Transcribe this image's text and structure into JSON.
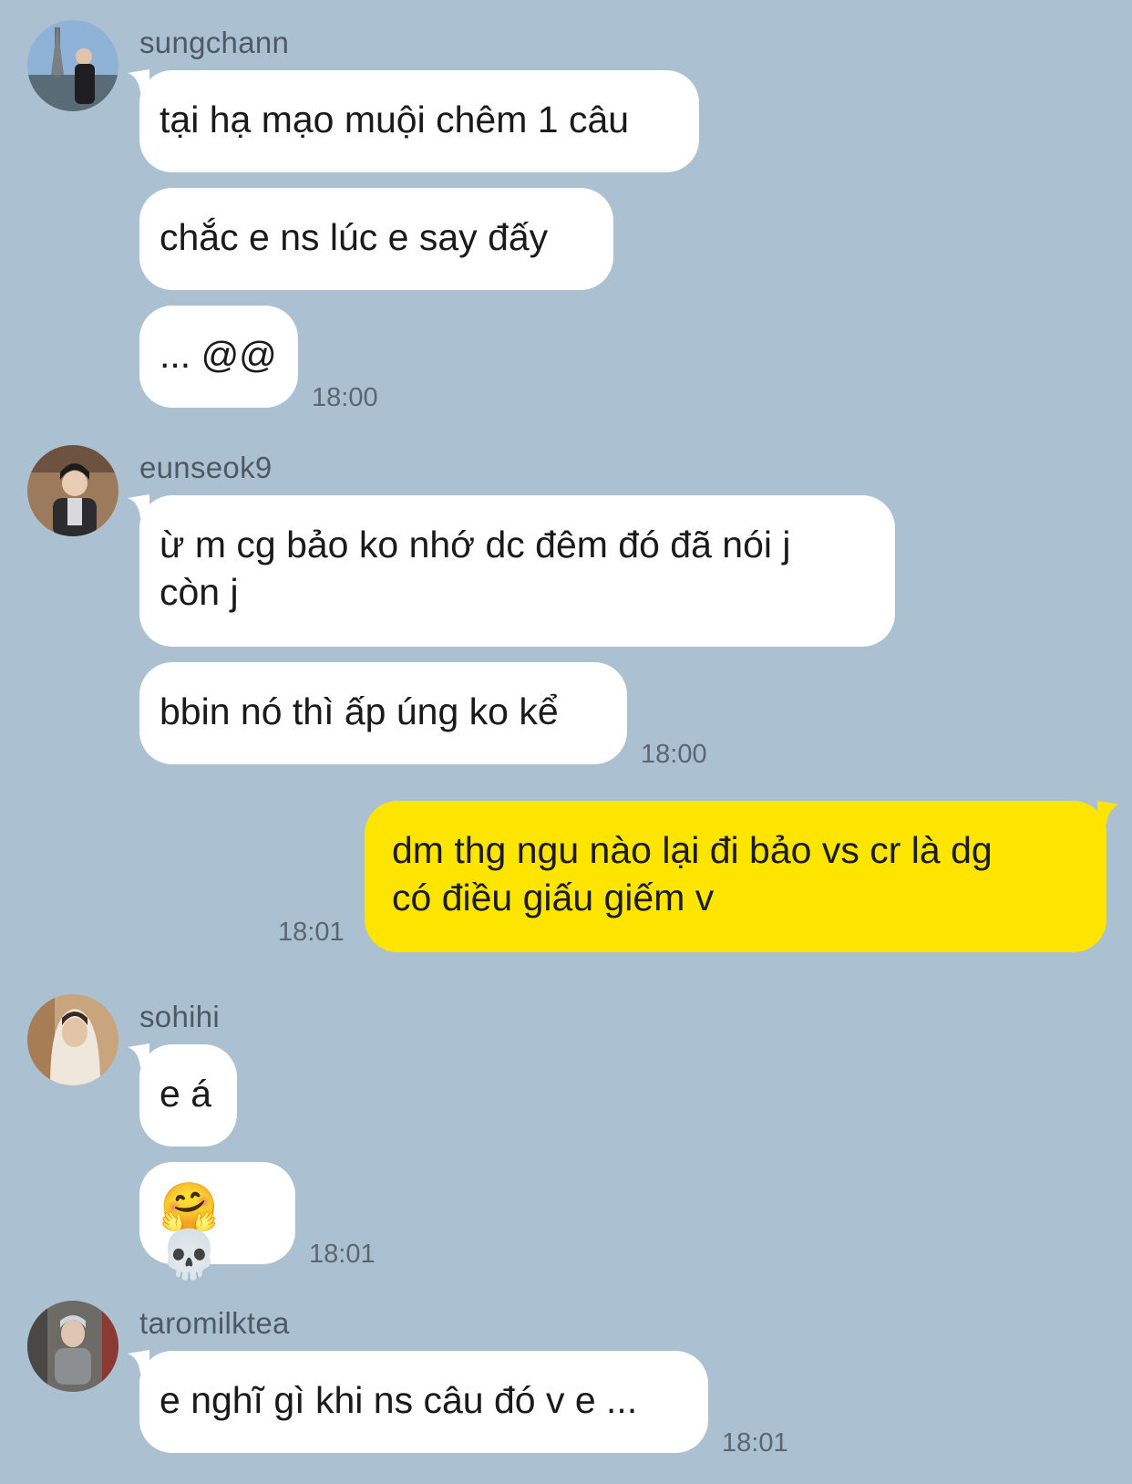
{
  "colors": {
    "background": "#abc1d1",
    "incoming_bubble": "#ffffff",
    "outgoing_bubble": "#fee500",
    "timestamp": "#5c6670",
    "sender_name": "#4f5965"
  },
  "groups": [
    {
      "sender": "sungchann",
      "avatar_icon": "user-avatar-photo",
      "messages": [
        "tại hạ mạo muội chêm 1 câu",
        "chắc e ns lúc e say đấy",
        "... @@"
      ],
      "time": "18:00"
    },
    {
      "sender": "eunseok9",
      "avatar_icon": "user-avatar-photo",
      "messages": [
        "ừ m cg bảo ko nhớ dc đêm đó đã nói j\ncòn j",
        "bbin nó thì ấp úng ko kể"
      ],
      "time": "18:00"
    },
    {
      "sender": "",
      "outgoing": true,
      "messages": [
        "dm thg ngu nào lại đi bảo vs cr là dg\ncó điều giấu giếm v"
      ],
      "time": "18:01"
    },
    {
      "sender": "sohihi",
      "avatar_icon": "user-avatar-photo",
      "messages": [
        "e á",
        "🤗 💀"
      ],
      "time": "18:01"
    },
    {
      "sender": "taromilktea",
      "avatar_icon": "user-avatar-photo",
      "messages": [
        "e nghĩ gì khi ns câu đó v e ..."
      ],
      "time": "18:01"
    }
  ]
}
